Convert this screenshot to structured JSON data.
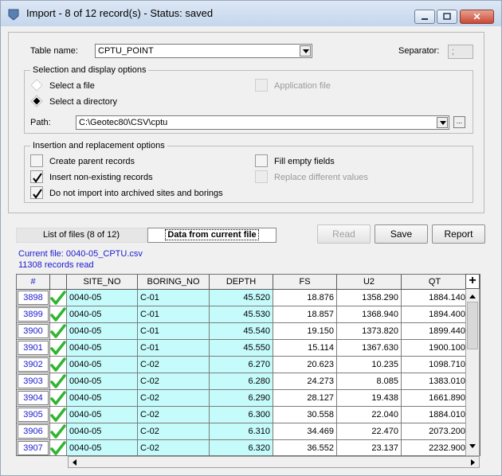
{
  "window": {
    "title": "Import - 8 of 12 record(s) - Status: saved",
    "minimize_label": "minimize",
    "maximize_label": "maximize",
    "close_label": "close"
  },
  "form": {
    "table_name_label": "Table name:",
    "table_name_value": "CPTU_POINT",
    "separator_label": "Separator:",
    "separator_value": ";",
    "selection_group_label": "Selection and display options",
    "select_file_label": "Select a file",
    "select_directory_label": "Select a directory",
    "application_file_label": "Application file",
    "path_label": "Path:",
    "path_value": "C:\\Geotec80\\CSV\\cptu",
    "browse_label": "...",
    "insertion_group_label": "Insertion and replacement options",
    "create_parent_label": "Create parent records",
    "insert_nonexisting_label": "Insert non-existing records",
    "no_archived_label": "Do not import into archived sites and borings",
    "fill_empty_label": "Fill empty fields",
    "replace_different_label": "Replace different values",
    "selected_mode": "directory",
    "checkbox_states": {
      "create_parent": false,
      "insert_nonexisting": true,
      "no_archived": true,
      "application_file": false,
      "fill_empty": false,
      "replace_different": false
    }
  },
  "tabs": {
    "list_of_files": "List of files (8 of 12)",
    "data_from_current_file": "Data from current file"
  },
  "buttons": {
    "read": "Read",
    "save": "Save",
    "report": "Report"
  },
  "status": {
    "current_file": "Current file: 0040-05_CPTU.csv",
    "records_read": "11308 records read"
  },
  "grid": {
    "columns": [
      "#",
      "",
      "SITE_NO",
      "BORING_NO",
      "DEPTH",
      "FS",
      "U2",
      "QT"
    ],
    "rows": [
      {
        "id": "3898",
        "site": "0040-05",
        "boring": "C-01",
        "depth": "45.520",
        "fs": "18.876",
        "u2": "1358.290",
        "qt": "1884.140"
      },
      {
        "id": "3899",
        "site": "0040-05",
        "boring": "C-01",
        "depth": "45.530",
        "fs": "18.857",
        "u2": "1368.940",
        "qt": "1894.400"
      },
      {
        "id": "3900",
        "site": "0040-05",
        "boring": "C-01",
        "depth": "45.540",
        "fs": "19.150",
        "u2": "1373.820",
        "qt": "1899.440"
      },
      {
        "id": "3901",
        "site": "0040-05",
        "boring": "C-01",
        "depth": "45.550",
        "fs": "15.114",
        "u2": "1367.630",
        "qt": "1900.100"
      },
      {
        "id": "3902",
        "site": "0040-05",
        "boring": "C-02",
        "depth": "6.270",
        "fs": "20.623",
        "u2": "10.235",
        "qt": "1098.710"
      },
      {
        "id": "3903",
        "site": "0040-05",
        "boring": "C-02",
        "depth": "6.280",
        "fs": "24.273",
        "u2": "8.085",
        "qt": "1383.010"
      },
      {
        "id": "3904",
        "site": "0040-05",
        "boring": "C-02",
        "depth": "6.290",
        "fs": "28.127",
        "u2": "19.438",
        "qt": "1661.890"
      },
      {
        "id": "3905",
        "site": "0040-05",
        "boring": "C-02",
        "depth": "6.300",
        "fs": "30.558",
        "u2": "22.040",
        "qt": "1884.010"
      },
      {
        "id": "3906",
        "site": "0040-05",
        "boring": "C-02",
        "depth": "6.310",
        "fs": "34.469",
        "u2": "22.470",
        "qt": "2073.200"
      },
      {
        "id": "3907",
        "site": "0040-05",
        "boring": "C-02",
        "depth": "6.320",
        "fs": "36.552",
        "u2": "23.137",
        "qt": "2232.900"
      }
    ],
    "add_label": "+"
  },
  "colors": {
    "accent_blue": "#1a1ad0",
    "cell_cyan": "#c6fbfb",
    "check_green": "#2fb52f"
  }
}
